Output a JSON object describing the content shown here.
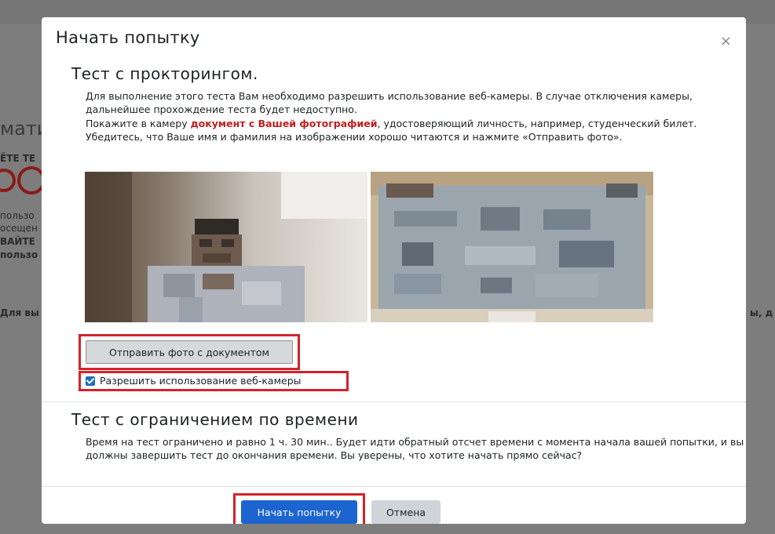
{
  "background": {
    "fragments": [
      "мати",
      "ЁТЕ ТЕ",
      "пользо",
      "осещен",
      "ВАЙТЕ",
      "пользо",
      "Для вы",
      "ы, д"
    ]
  },
  "modal": {
    "title": "Начать попытку",
    "close_label": "×",
    "proctoring": {
      "heading": "Тест с прокторингом.",
      "para1": "Для выполнение этого теста Вам необходимо разрешить использование веб-камеры. В случае отключения камеры, дальнейшее прохождение теста будет недоступно.",
      "para2_before": "Покажите в камеру ",
      "para2_highlight": "документ с Вашей фотографией",
      "para2_after": ", удостоверяющий личность, например, студенческий билет. Убедитесь, что Ваше имя и фамилия на изображении хорошо читаются и нажмите «Отправить фото».",
      "send_button": "Отправить фото с документом",
      "checkbox_label": "Разрешить использование веб-камеры",
      "checkbox_checked": true
    },
    "time_limit": {
      "heading": "Тест с ограничением по времени",
      "text": "Время на тест ограничено и равно 1 ч. 30 мин.. Будет идти обратный отсчет времени с момента начала вашей попытки, и вы должны завершить тест до окончания времени. Вы уверены, что хотите начать прямо сейчас?"
    },
    "footer": {
      "start_button": "Начать попытку",
      "cancel_button": "Отмена"
    }
  },
  "colors": {
    "primary": "#1c64d0",
    "highlight_red": "#d2232a",
    "overlay": "#7b7b7b"
  }
}
